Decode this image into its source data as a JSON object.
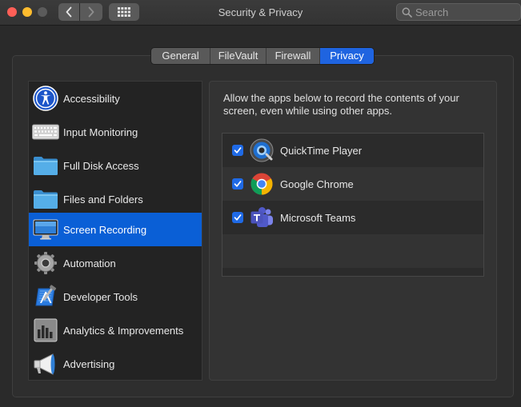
{
  "window": {
    "title": "Security & Privacy"
  },
  "toolbar": {
    "back": "back",
    "forward": "forward",
    "search_placeholder": "Search"
  },
  "tabs": [
    {
      "label": "General",
      "selected": false
    },
    {
      "label": "FileVault",
      "selected": false
    },
    {
      "label": "Firewall",
      "selected": false
    },
    {
      "label": "Privacy",
      "selected": true
    }
  ],
  "sidebar": {
    "items": [
      {
        "label": "Accessibility",
        "icon": "accessibility-icon"
      },
      {
        "label": "Input Monitoring",
        "icon": "keyboard-icon"
      },
      {
        "label": "Full Disk Access",
        "icon": "folder-icon"
      },
      {
        "label": "Files and Folders",
        "icon": "folder-icon"
      },
      {
        "label": "Screen Recording",
        "icon": "display-icon",
        "selected": true
      },
      {
        "label": "Automation",
        "icon": "gear-icon"
      },
      {
        "label": "Developer Tools",
        "icon": "developer-tools-icon"
      },
      {
        "label": "Analytics & Improvements",
        "icon": "analytics-icon"
      },
      {
        "label": "Advertising",
        "icon": "megaphone-icon"
      }
    ]
  },
  "content": {
    "description": "Allow the apps below to record the contents of your screen, even while using other apps.",
    "apps": [
      {
        "name": "QuickTime Player",
        "checked": true,
        "icon": "quicktime-icon"
      },
      {
        "name": "Google Chrome",
        "checked": true,
        "icon": "chrome-icon"
      },
      {
        "name": "Microsoft Teams",
        "checked": true,
        "icon": "teams-icon"
      }
    ]
  },
  "colors": {
    "accent": "#1f64e0",
    "selection": "#0a5fd6"
  }
}
